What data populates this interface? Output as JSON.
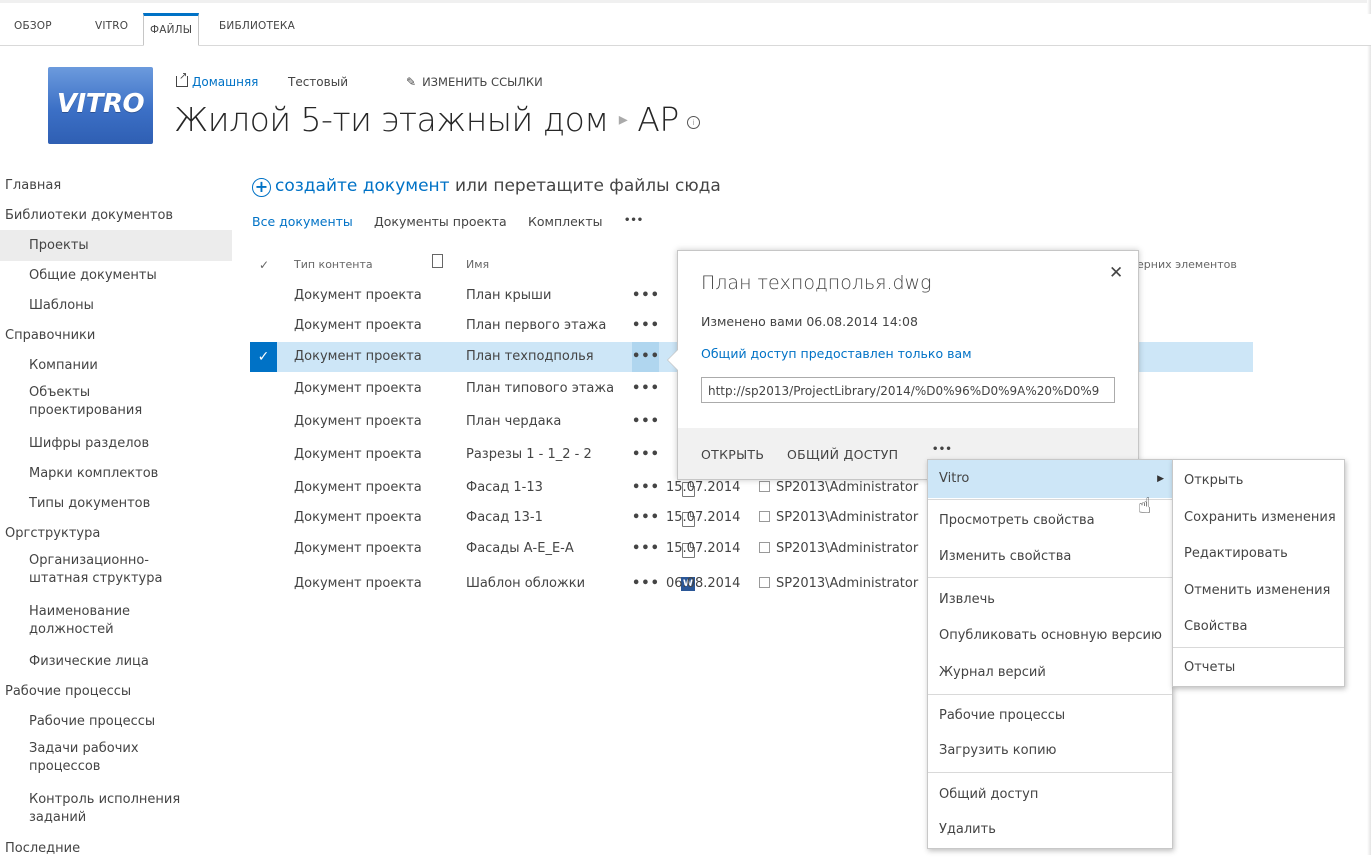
{
  "ribbon": {
    "tabs": [
      {
        "label": "ОБЗОР",
        "active": false
      },
      {
        "label": "VITRO",
        "active": false
      },
      {
        "label": "ФАЙЛЫ",
        "active": true
      },
      {
        "label": "БИБЛИОТЕКА",
        "active": false
      }
    ]
  },
  "header": {
    "logo_text": "VITRO",
    "home_link": "Домашняя",
    "test_link": "Тестовый",
    "edit_links": "ИЗМЕНИТЬ ССЫЛКИ",
    "site_title": "Жилой 5-ти этажный дом",
    "sub_title": "АР"
  },
  "sidebar": {
    "items": [
      {
        "label": "Главная",
        "indent": false,
        "selected": false
      },
      {
        "label": "Библиотеки документов",
        "indent": false,
        "selected": false
      },
      {
        "label": "Проекты",
        "indent": true,
        "selected": true
      },
      {
        "label": "Общие документы",
        "indent": true,
        "selected": false
      },
      {
        "label": "Шаблоны",
        "indent": true,
        "selected": false
      },
      {
        "label": "Справочники",
        "indent": false,
        "selected": false
      },
      {
        "label": "Компании",
        "indent": true,
        "selected": false
      },
      {
        "label": "Объекты проектирования",
        "indent": true,
        "selected": false
      },
      {
        "label": "Шифры разделов",
        "indent": true,
        "selected": false
      },
      {
        "label": "Марки комплектов",
        "indent": true,
        "selected": false
      },
      {
        "label": "Типы документов",
        "indent": true,
        "selected": false
      },
      {
        "label": "Оргструктура",
        "indent": false,
        "selected": false
      },
      {
        "label": "Организационно-штатная структура",
        "indent": true,
        "selected": false
      },
      {
        "label": "Наименование должностей",
        "indent": true,
        "selected": false
      },
      {
        "label": "Физические лица",
        "indent": true,
        "selected": false
      },
      {
        "label": "Рабочие процессы",
        "indent": false,
        "selected": false
      },
      {
        "label": "Рабочие процессы",
        "indent": true,
        "selected": false
      },
      {
        "label": "Задачи рабочих процессов",
        "indent": true,
        "selected": false
      },
      {
        "label": "Контроль исполнения заданий",
        "indent": true,
        "selected": false
      },
      {
        "label": "Последние",
        "indent": false,
        "selected": false
      }
    ]
  },
  "main": {
    "new_doc_link": "создайте документ",
    "new_doc_rest": "или перетащите файлы сюда",
    "views": [
      "Все документы",
      "Документы проекта",
      "Комплекты",
      "•••"
    ],
    "columns": {
      "check": "✓",
      "type": "Тип контента",
      "name": "Имя",
      "right_partial": "ерних элементов"
    },
    "rows": [
      {
        "type": "Документ проекта",
        "name": "План крыши",
        "icon": "doc",
        "date": "",
        "author": ""
      },
      {
        "type": "Документ проекта",
        "name": "План первого этажа",
        "icon": "doc",
        "date": "",
        "author": ""
      },
      {
        "type": "Документ проекта",
        "name": "План техподполья",
        "icon": "doc",
        "date": "",
        "author": "",
        "selected": true
      },
      {
        "type": "Документ проекта",
        "name": "План типового этажа",
        "icon": "doc",
        "date": "",
        "author": ""
      },
      {
        "type": "Документ проекта",
        "name": "План чердака",
        "icon": "doc",
        "date": "",
        "author": ""
      },
      {
        "type": "Документ проекта",
        "name": "Разрезы 1 - 1_2 - 2",
        "icon": "doc",
        "date": "",
        "author": ""
      },
      {
        "type": "Документ проекта",
        "name": "Фасад 1-13",
        "icon": "doc",
        "date": "15.07.2014",
        "author": "SP2013\\Administrator"
      },
      {
        "type": "Документ проекта",
        "name": "Фасад 13-1",
        "icon": "doc",
        "date": "15.07.2014",
        "author": "SP2013\\Administrator"
      },
      {
        "type": "Документ проекта",
        "name": "Фасады А-Е_Е-А",
        "icon": "doc",
        "date": "15.07.2014",
        "author": "SP2013\\Administrator"
      },
      {
        "type": "Документ проекта",
        "name": "Шаблон обложки",
        "icon": "word",
        "date": "06.08.2014",
        "author": "SP2013\\Administrator"
      }
    ],
    "dots": "•••"
  },
  "callout": {
    "title": "План техподполья.dwg",
    "modified": "Изменено вами 06.08.2014 14:08",
    "shared": "Общий доступ предоставлен только вам",
    "url": "http://sp2013/ProjectLibrary/2014/%D0%96%D0%9A%20%D0%9",
    "open": "ОТКРЫТЬ",
    "share": "ОБЩИЙ ДОСТУП",
    "more": "•••",
    "close": "✕"
  },
  "menu": {
    "items": [
      "Vitro",
      "Просмотреть свойства",
      "Изменить свойства",
      "Извлечь",
      "Опубликовать основную версию",
      "Журнал версий",
      "Рабочие процессы",
      "Загрузить копию",
      "Общий доступ",
      "Удалить"
    ]
  },
  "submenu": {
    "items": [
      "Открыть",
      "Сохранить изменения",
      "Редактировать",
      "Отменить изменения",
      "Свойства",
      "Отчеты"
    ]
  },
  "colors": {
    "accent": "#0072c6",
    "selection": "#cde6f7"
  }
}
